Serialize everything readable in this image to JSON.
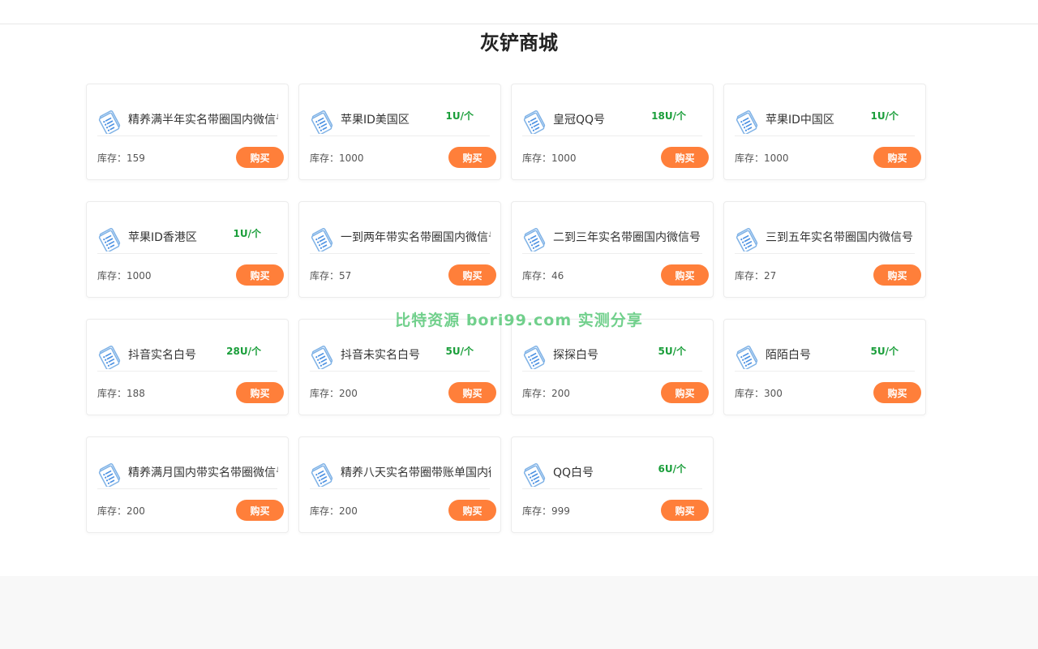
{
  "header": {
    "title": "灰铲商城"
  },
  "watermark": "比特资源 bori99.com 实测分享",
  "labels": {
    "stock_prefix": "库存：",
    "buy": "购买"
  },
  "colors": {
    "price": "#1a9e3a",
    "buy_button": "#ff7f3a"
  },
  "products": [
    {
      "name": "精养满半年实名带圈国内微信号",
      "price": "",
      "stock": "159"
    },
    {
      "name": "苹果ID美国区",
      "price": "1U/个",
      "stock": "1000"
    },
    {
      "name": "皇冠QQ号",
      "price": "18U/个",
      "stock": "1000"
    },
    {
      "name": "苹果ID中国区",
      "price": "1U/个",
      "stock": "1000"
    },
    {
      "name": "苹果ID香港区",
      "price": "1U/个",
      "stock": "1000"
    },
    {
      "name": "一到两年带实名带圈国内微信号",
      "price": "",
      "stock": "57"
    },
    {
      "name": "二到三年实名带圈国内微信号",
      "price": "",
      "stock": "46"
    },
    {
      "name": "三到五年实名带圈国内微信号",
      "price": "",
      "stock": "27"
    },
    {
      "name": "抖音实名白号",
      "price": "28U/个",
      "stock": "188"
    },
    {
      "name": "抖音未实名白号",
      "price": "5U/个",
      "stock": "200"
    },
    {
      "name": "探探白号",
      "price": "5U/个",
      "stock": "200"
    },
    {
      "name": "陌陌白号",
      "price": "5U/个",
      "stock": "300"
    },
    {
      "name": "精养满月国内带实名带圈微信号",
      "price": "",
      "stock": "200"
    },
    {
      "name": "精养八天实名带圈带账单国内微信号",
      "price": "",
      "stock": "200"
    },
    {
      "name": "QQ白号",
      "price": "6U/个",
      "stock": "999"
    }
  ]
}
